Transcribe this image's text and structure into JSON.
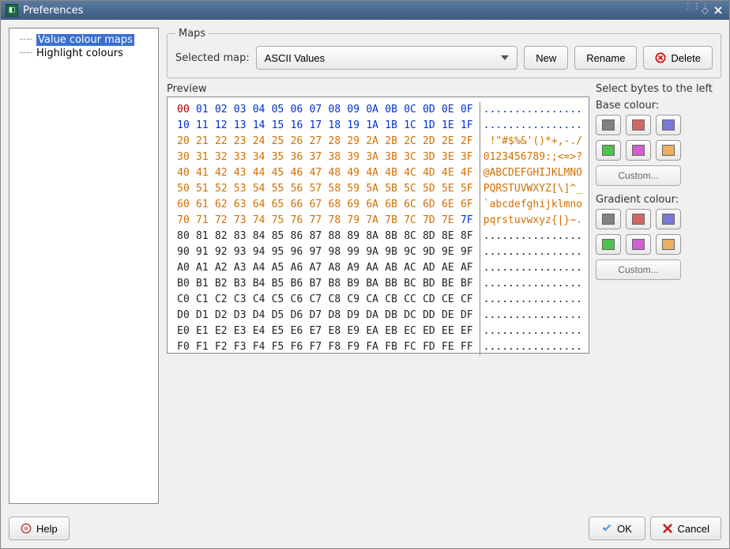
{
  "window": {
    "title": "Preferences"
  },
  "sidebar": {
    "items": [
      {
        "label": "Value colour maps",
        "selected": true
      },
      {
        "label": "Highlight colours",
        "selected": false
      }
    ]
  },
  "maps": {
    "legend": "Maps",
    "selectedLabel": "Selected map:",
    "selectedValue": "ASCII Values",
    "newLabel": "New",
    "renameLabel": "Rename",
    "deleteLabel": "Delete"
  },
  "preview": {
    "label": "Preview",
    "sideTitle": "Select bytes to the left",
    "baseLabel": "Base colour:",
    "gradLabel": "Gradient colour:",
    "customLabel": "Custom...",
    "swatchColours": [
      "#808080",
      "#d06868",
      "#7878d8",
      "#50c050",
      "#d060d0",
      "#e8b060"
    ],
    "rows": [
      {
        "hex": [
          "00",
          "01",
          "02",
          "03",
          "04",
          "05",
          "06",
          "07",
          "08",
          "09",
          "0A",
          "0B",
          "0C",
          "0D",
          "0E",
          "0F"
        ],
        "ascii": "................",
        "colourClass": "c-blue",
        "firstClass": "c-dkred"
      },
      {
        "hex": [
          "10",
          "11",
          "12",
          "13",
          "14",
          "15",
          "16",
          "17",
          "18",
          "19",
          "1A",
          "1B",
          "1C",
          "1D",
          "1E",
          "1F"
        ],
        "ascii": "................",
        "colourClass": "c-blue"
      },
      {
        "hex": [
          "20",
          "21",
          "22",
          "23",
          "24",
          "25",
          "26",
          "27",
          "28",
          "29",
          "2A",
          "2B",
          "2C",
          "2D",
          "2E",
          "2F"
        ],
        "ascii": " !\"#$%&'()*+,-./",
        "colourClass": "c-orange"
      },
      {
        "hex": [
          "30",
          "31",
          "32",
          "33",
          "34",
          "35",
          "36",
          "37",
          "38",
          "39",
          "3A",
          "3B",
          "3C",
          "3D",
          "3E",
          "3F"
        ],
        "ascii": "0123456789:;<=>?",
        "colourClass": "c-orange"
      },
      {
        "hex": [
          "40",
          "41",
          "42",
          "43",
          "44",
          "45",
          "46",
          "47",
          "48",
          "49",
          "4A",
          "4B",
          "4C",
          "4D",
          "4E",
          "4F"
        ],
        "ascii": "@ABCDEFGHIJKLMNO",
        "colourClass": "c-orange"
      },
      {
        "hex": [
          "50",
          "51",
          "52",
          "53",
          "54",
          "55",
          "56",
          "57",
          "58",
          "59",
          "5A",
          "5B",
          "5C",
          "5D",
          "5E",
          "5F"
        ],
        "ascii": "PQRSTUVWXYZ[\\]^_",
        "colourClass": "c-orange"
      },
      {
        "hex": [
          "60",
          "61",
          "62",
          "63",
          "64",
          "65",
          "66",
          "67",
          "68",
          "69",
          "6A",
          "6B",
          "6C",
          "6D",
          "6E",
          "6F"
        ],
        "ascii": "`abcdefghijklmno",
        "colourClass": "c-orange"
      },
      {
        "hex": [
          "70",
          "71",
          "72",
          "73",
          "74",
          "75",
          "76",
          "77",
          "78",
          "79",
          "7A",
          "7B",
          "7C",
          "7D",
          "7E",
          "7F"
        ],
        "ascii": "pqrstuvwxyz{|}~.",
        "colourClass": "c-orange",
        "lastClass": "c-blue"
      },
      {
        "hex": [
          "80",
          "81",
          "82",
          "83",
          "84",
          "85",
          "86",
          "87",
          "88",
          "89",
          "8A",
          "8B",
          "8C",
          "8D",
          "8E",
          "8F"
        ],
        "ascii": "................",
        "colourClass": "c-black"
      },
      {
        "hex": [
          "90",
          "91",
          "92",
          "93",
          "94",
          "95",
          "96",
          "97",
          "98",
          "99",
          "9A",
          "9B",
          "9C",
          "9D",
          "9E",
          "9F"
        ],
        "ascii": "................",
        "colourClass": "c-black"
      },
      {
        "hex": [
          "A0",
          "A1",
          "A2",
          "A3",
          "A4",
          "A5",
          "A6",
          "A7",
          "A8",
          "A9",
          "AA",
          "AB",
          "AC",
          "AD",
          "AE",
          "AF"
        ],
        "ascii": "................",
        "colourClass": "c-black"
      },
      {
        "hex": [
          "B0",
          "B1",
          "B2",
          "B3",
          "B4",
          "B5",
          "B6",
          "B7",
          "B8",
          "B9",
          "BA",
          "BB",
          "BC",
          "BD",
          "BE",
          "BF"
        ],
        "ascii": "................",
        "colourClass": "c-black"
      },
      {
        "hex": [
          "C0",
          "C1",
          "C2",
          "C3",
          "C4",
          "C5",
          "C6",
          "C7",
          "C8",
          "C9",
          "CA",
          "CB",
          "CC",
          "CD",
          "CE",
          "CF"
        ],
        "ascii": "................",
        "colourClass": "c-black"
      },
      {
        "hex": [
          "D0",
          "D1",
          "D2",
          "D3",
          "D4",
          "D5",
          "D6",
          "D7",
          "D8",
          "D9",
          "DA",
          "DB",
          "DC",
          "DD",
          "DE",
          "DF"
        ],
        "ascii": "................",
        "colourClass": "c-black"
      },
      {
        "hex": [
          "E0",
          "E1",
          "E2",
          "E3",
          "E4",
          "E5",
          "E6",
          "E7",
          "E8",
          "E9",
          "EA",
          "EB",
          "EC",
          "ED",
          "EE",
          "EF"
        ],
        "ascii": "................",
        "colourClass": "c-black"
      },
      {
        "hex": [
          "F0",
          "F1",
          "F2",
          "F3",
          "F4",
          "F5",
          "F6",
          "F7",
          "F8",
          "F9",
          "FA",
          "FB",
          "FC",
          "FD",
          "FE",
          "FF"
        ],
        "ascii": "................",
        "colourClass": "c-black"
      }
    ]
  },
  "footer": {
    "helpLabel": "Help",
    "okLabel": "OK",
    "cancelLabel": "Cancel"
  }
}
